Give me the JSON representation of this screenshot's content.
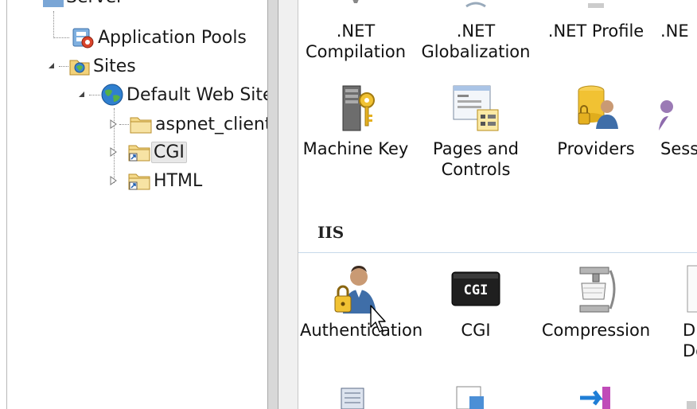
{
  "tree": {
    "nodes": [
      {
        "label": "Server"
      },
      {
        "label": "Application Pools"
      },
      {
        "label": "Sites"
      },
      {
        "label": "Default Web Site"
      },
      {
        "label": "aspnet_client"
      },
      {
        "label": "CGI"
      },
      {
        "label": "HTML"
      }
    ]
  },
  "features": {
    "top_row": [
      {
        "label": ".NET Compilation",
        "icon": "net-compilation-icon"
      },
      {
        "label": ".NET Globalization",
        "icon": "net-globalization-icon"
      },
      {
        "label": ".NET Profile",
        "icon": "net-profile-icon"
      },
      {
        "label": ".NE",
        "icon": "net-icon"
      }
    ],
    "row2": [
      {
        "label": "Machine Key",
        "icon": "machine-key-icon"
      },
      {
        "label": "Pages and Controls",
        "icon": "pages-controls-icon"
      },
      {
        "label": "Providers",
        "icon": "providers-icon"
      },
      {
        "label": "Sess",
        "icon": "session-icon"
      }
    ],
    "group_iis": "IIS",
    "iis_row": [
      {
        "label": "Authentication",
        "icon": "authentication-icon"
      },
      {
        "label": "CGI",
        "icon": "cgi-icon"
      },
      {
        "label": "Compression",
        "icon": "compression-icon"
      },
      {
        "label": "D Do",
        "icon": "default-document-icon"
      }
    ],
    "cgi_icon_text": "CGI"
  }
}
